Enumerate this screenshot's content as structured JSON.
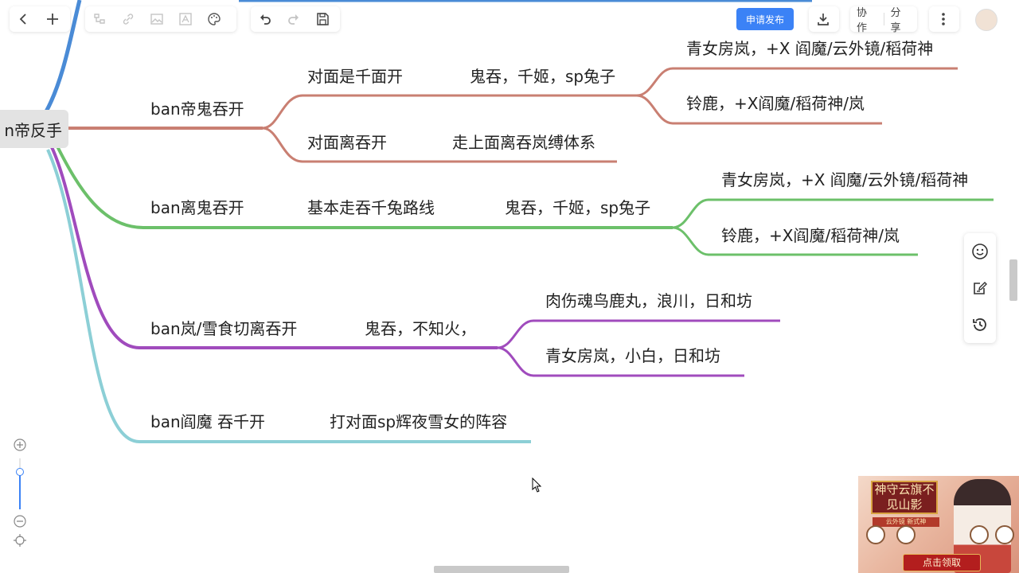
{
  "toolbar": {
    "publish_label": "申请发布",
    "collab_label": "协作",
    "share_label": "分享"
  },
  "mindmap": {
    "root": "n帝反手",
    "branches": [
      {
        "label": "ban帝鬼吞开",
        "color": "#c97f72",
        "children": [
          {
            "label": "对面是千面开",
            "next": "鬼吞，千姬，sp兔子",
            "leaves": [
              "青女房岚，+X 阎魔/云外镜/稻荷神",
              "铃鹿，+X阎魔/稻荷神/岚"
            ]
          },
          {
            "label": "对面离吞开",
            "next": "走上面离吞岚缚体系"
          }
        ]
      },
      {
        "label": "ban离鬼吞开",
        "color": "#6cc06a",
        "children": [
          {
            "label": "基本走吞千兔路线",
            "next": "鬼吞，千姬，sp兔子",
            "leaves": [
              "青女房岚，+X 阎魔/云外镜/稻荷神",
              "铃鹿，+X阎魔/稻荷神/岚"
            ]
          }
        ]
      },
      {
        "label": "ban岚/雪食切离吞开",
        "color": "#a04bbd",
        "children": [
          {
            "label": "鬼吞，不知火，",
            "leaves": [
              "肉伤魂鸟鹿丸，浪川，日和坊",
              "青女房岚，小白，日和坊"
            ]
          }
        ]
      },
      {
        "label": "ban阎魔 吞千开",
        "color": "#8ccfd6",
        "children": [
          {
            "label": "打对面sp辉夜雪女的阵容"
          }
        ]
      }
    ]
  },
  "ad": {
    "title": "神守云旗不见山影",
    "subtitle": "云外镜 新式神",
    "claim_label": "点击领取"
  }
}
